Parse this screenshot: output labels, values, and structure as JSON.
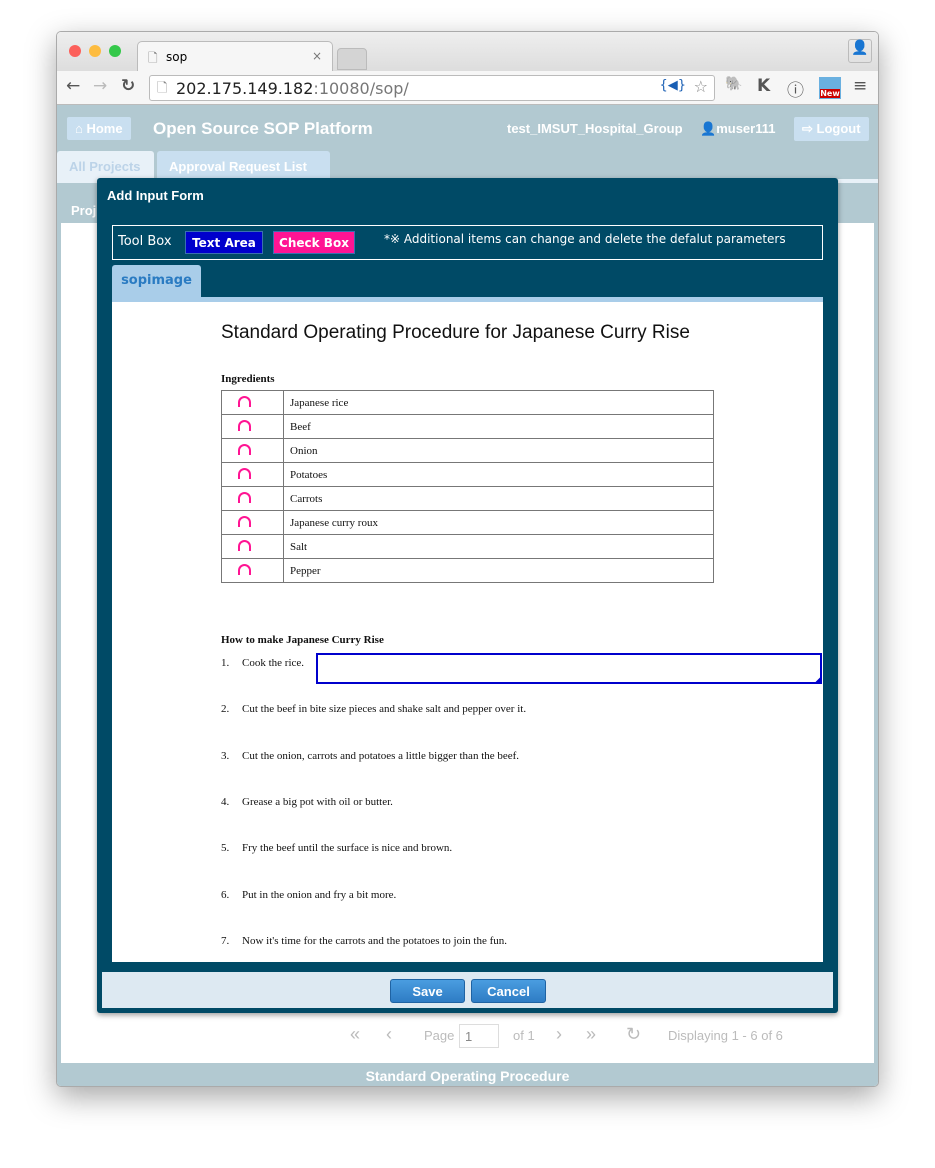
{
  "browser": {
    "tab_title": "sop",
    "url_host": "202.175.149.182",
    "url_rest": ":10080/sop/"
  },
  "header": {
    "home": "Home",
    "title": "Open Source SOP Platform",
    "group": "test_IMSUT_Hospital_Group",
    "user": "muser111",
    "logout": "Logout"
  },
  "tabs": [
    "All Projects",
    "Approval Request List"
  ],
  "behind": {
    "proj_label": "Proj"
  },
  "dialog": {
    "title": "Add Input Form",
    "toolbox_label": "Tool Box",
    "text_area": "Text Area",
    "check_box": "Check Box",
    "note": "*※ Additional items can change and delete the defalut parameters",
    "tab": "sopimage",
    "colors": {
      "text_area": "#0000cc",
      "check_box": "#ff1493",
      "dialog": "#004a66"
    },
    "doc": {
      "title": "Standard Operating Procedure for Japanese Curry Rise",
      "ingredients_heading": "Ingredients",
      "ingredients": [
        "Japanese rice",
        "Beef",
        "Onion",
        "Potatoes",
        "Carrots",
        "Japanese curry roux",
        "Salt",
        "Pepper"
      ],
      "howto_heading": "How to make Japanese Curry Rise",
      "steps": [
        {
          "n": "1.",
          "t": "Cook the rice."
        },
        {
          "n": "2.",
          "t": "Cut the beef in bite size pieces and shake salt and pepper over it."
        },
        {
          "n": "3.",
          "t": "Cut the onion, carrots and potatoes a little bigger than the beef."
        },
        {
          "n": "4.",
          "t": "Grease a big pot with oil or butter."
        },
        {
          "n": "5.",
          "t": "Fry the beef until the surface is nice and brown."
        },
        {
          "n": "6.",
          "t": "Put in the onion and fry a bit more."
        },
        {
          "n": "7.",
          "t": "Now it's time for the carrots and the potatoes to join the fun."
        }
      ]
    },
    "save": "Save",
    "cancel": "Cancel"
  },
  "pager": {
    "page_label": "Page",
    "page_value": "1",
    "of": "of 1",
    "display": "Displaying 1 - 6 of 6"
  },
  "footer": "Standard Operating Procedure"
}
